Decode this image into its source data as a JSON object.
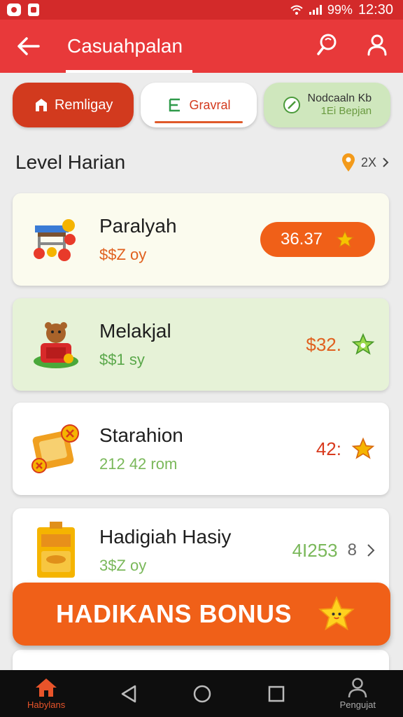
{
  "status_bar": {
    "battery": "99%",
    "time": "12:30"
  },
  "app_bar": {
    "title": "Casuahpalan"
  },
  "chips": [
    {
      "label": "Remligay"
    },
    {
      "label": "Gravral"
    },
    {
      "label": "Nodcaaln Kb",
      "sublabel": "1Ei Bepjan"
    }
  ],
  "section": {
    "title": "Level Harian",
    "link_text": "2X"
  },
  "cards": [
    {
      "name": "Paralyah",
      "sub": "$$Z oy",
      "value": "36.37"
    },
    {
      "name": "Melakjal",
      "sub": "$$1 sy",
      "value": "$32."
    },
    {
      "name": "Starahion",
      "sub": "212 42  rom",
      "value": "42:"
    },
    {
      "name": "Hadigiah Hasiy",
      "sub": "3$Z oy",
      "value": "4I253",
      "count": "8"
    }
  ],
  "bonus_button": {
    "label": "HADIKANS BONUS"
  },
  "bottom_nav": {
    "home_label": "Habylans",
    "profile_label": "Pengujat"
  },
  "colors": {
    "primary": "#e8393a",
    "accent": "#f06018",
    "green": "#6aa84f",
    "star": "#f5b400"
  }
}
